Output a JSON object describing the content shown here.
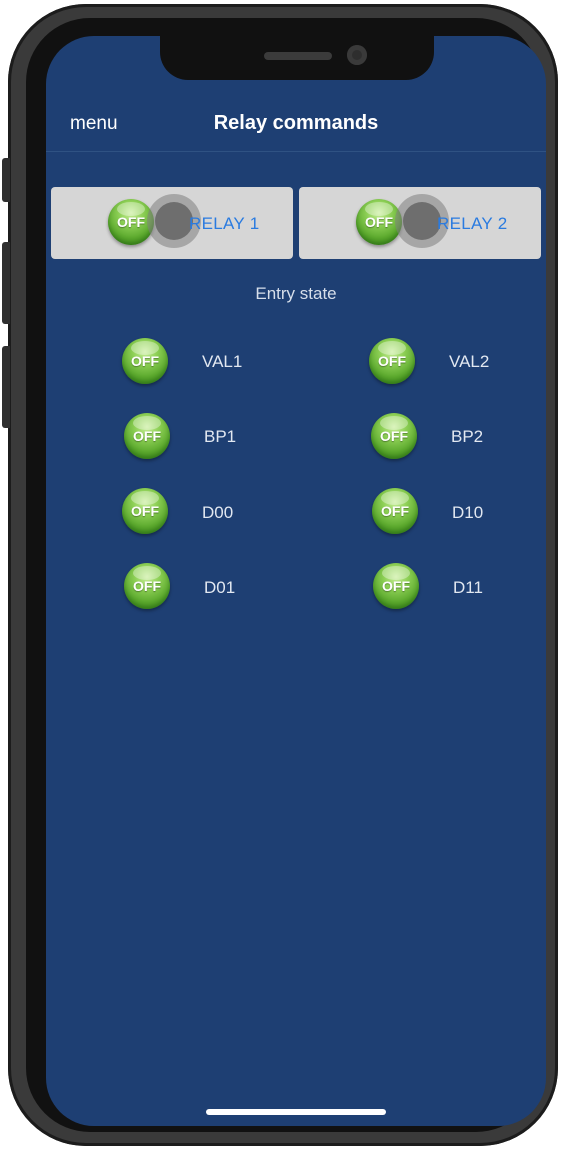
{
  "nav": {
    "menu_label": "menu",
    "title": "Relay commands"
  },
  "relays": [
    {
      "label": "RELAY 1",
      "state": "OFF"
    },
    {
      "label": "RELAY 2",
      "state": "OFF"
    }
  ],
  "entry_section": {
    "title": "Entry state",
    "left_column": [
      {
        "label": "VAL1",
        "state": "OFF"
      },
      {
        "label": "BP1",
        "state": "OFF"
      },
      {
        "label": "D00",
        "state": "OFF"
      },
      {
        "label": "D01",
        "state": "OFF"
      }
    ],
    "right_column": [
      {
        "label": "VAL2",
        "state": "OFF"
      },
      {
        "label": "BP2",
        "state": "OFF"
      },
      {
        "label": "D10",
        "state": "OFF"
      },
      {
        "label": "D11",
        "state": "OFF"
      }
    ]
  },
  "colors": {
    "background": "#1e3f73",
    "relay_card": "#d6d6d6",
    "relay_label": "#2a7be0",
    "led_green": "#5aa82c"
  }
}
